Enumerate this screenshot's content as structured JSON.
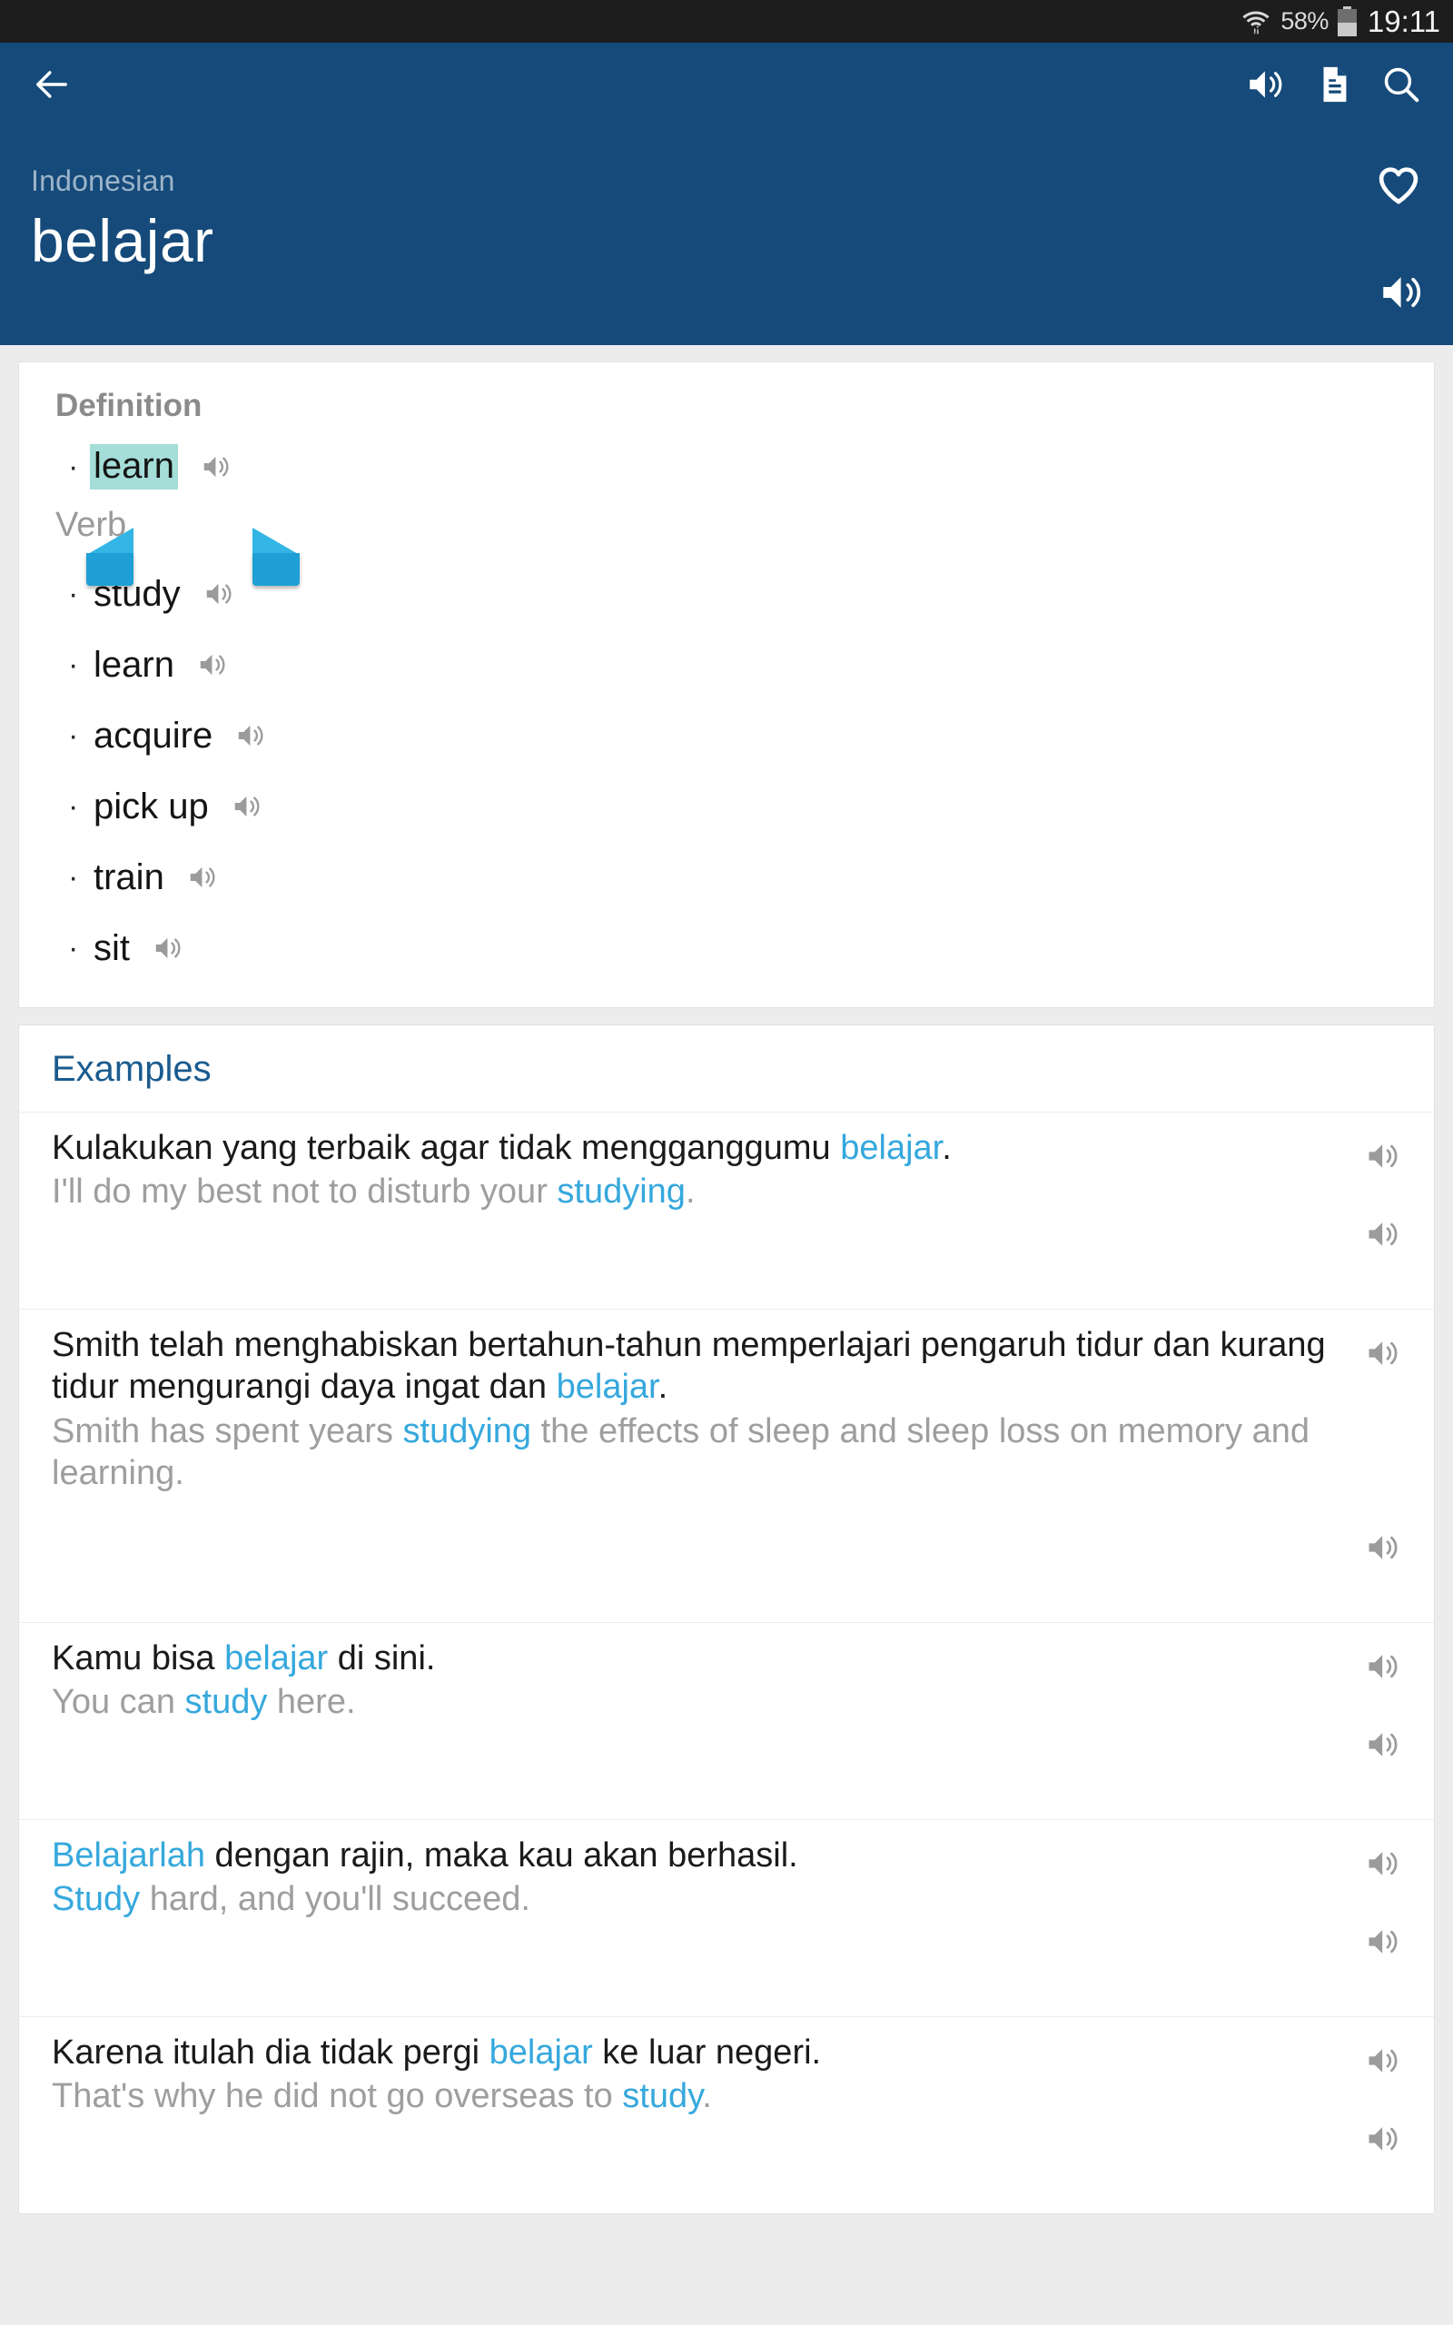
{
  "statusbar": {
    "battery_percent": "58%",
    "clock": "19:11",
    "wifi_icon": "wifi-icon",
    "battery_icon": "battery-icon"
  },
  "appbar": {
    "back_icon": "back-arrow-icon",
    "speaker_icon": "speaker-icon",
    "document_icon": "document-icon",
    "search_icon": "search-icon"
  },
  "word_header": {
    "language": "Indonesian",
    "headword": "belajar",
    "favorite_icon": "heart-outline-icon",
    "speaker_icon": "speaker-icon"
  },
  "definition": {
    "title": "Definition",
    "selected_word": "learn",
    "part_of_speech": "Verb",
    "senses": [
      {
        "word": "study"
      },
      {
        "word": "learn"
      },
      {
        "word": "acquire"
      },
      {
        "word": "pick up"
      },
      {
        "word": "train"
      },
      {
        "word": "sit"
      }
    ]
  },
  "examples": {
    "title": "Examples",
    "items": [
      {
        "source_pre": "Kulakukan yang terbaik agar tidak mengganggumu ",
        "source_hl": "belajar",
        "source_post": ".",
        "target_pre": "I'll do my best not to disturb your ",
        "target_hl": "studying",
        "target_post": "."
      },
      {
        "source_pre": "Smith telah menghabiskan bertahun-tahun memperlajari pengaruh tidur dan kurang tidur mengurangi daya ingat dan ",
        "source_hl": "belajar",
        "source_post": ".",
        "target_pre": "Smith has spent years ",
        "target_hl": "studying",
        "target_post": " the effects of sleep and sleep loss on memory and learning."
      },
      {
        "source_pre": "Kamu bisa ",
        "source_hl": "belajar",
        "source_post": " di sini.",
        "target_pre": "You can ",
        "target_hl": "study",
        "target_post": " here."
      },
      {
        "source_pre": "",
        "source_hl": "Belajarlah",
        "source_post": " dengan rajin, maka kau akan berhasil.",
        "target_pre": "",
        "target_hl": "Study",
        "target_post": " hard, and you'll succeed."
      },
      {
        "source_pre": "Karena itulah dia tidak pergi ",
        "source_hl": "belajar",
        "source_post": " ke luar negeri.",
        "target_pre": "That's why he did not go overseas to ",
        "target_hl": "study",
        "target_post": "."
      }
    ]
  },
  "colors": {
    "header_blue": "#154a7a",
    "accent_blue": "#35a8dd",
    "selection_highlight": "#a5ded9",
    "handle_blue": "#1e9fd6",
    "statusbar_bg": "#1d1d1d",
    "muted_text": "#9e9e9e"
  }
}
